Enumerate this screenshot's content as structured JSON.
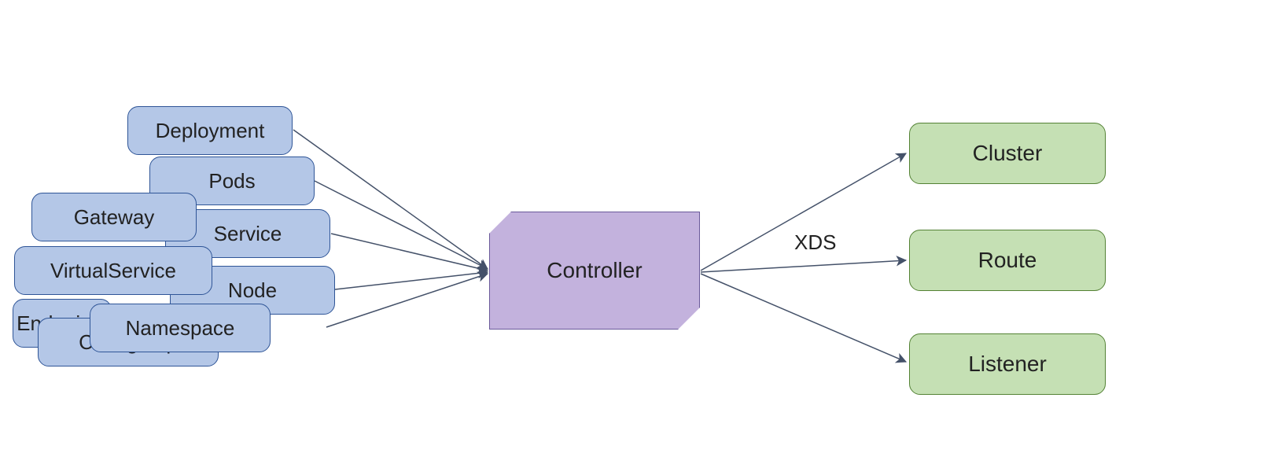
{
  "diagram": {
    "inputs": {
      "deployment": "Deployment",
      "pods": "Pods",
      "gateway": "Gateway",
      "service": "Service",
      "virtualservice": "VirtualService",
      "node": "Node",
      "namespace": "Namespace",
      "configmap": "ConfigMap",
      "endpoints": "Endpoints"
    },
    "controller": "Controller",
    "outputs": {
      "cluster": "Cluster",
      "route": "Route",
      "listener": "Listener"
    },
    "edge_label": "XDS"
  }
}
